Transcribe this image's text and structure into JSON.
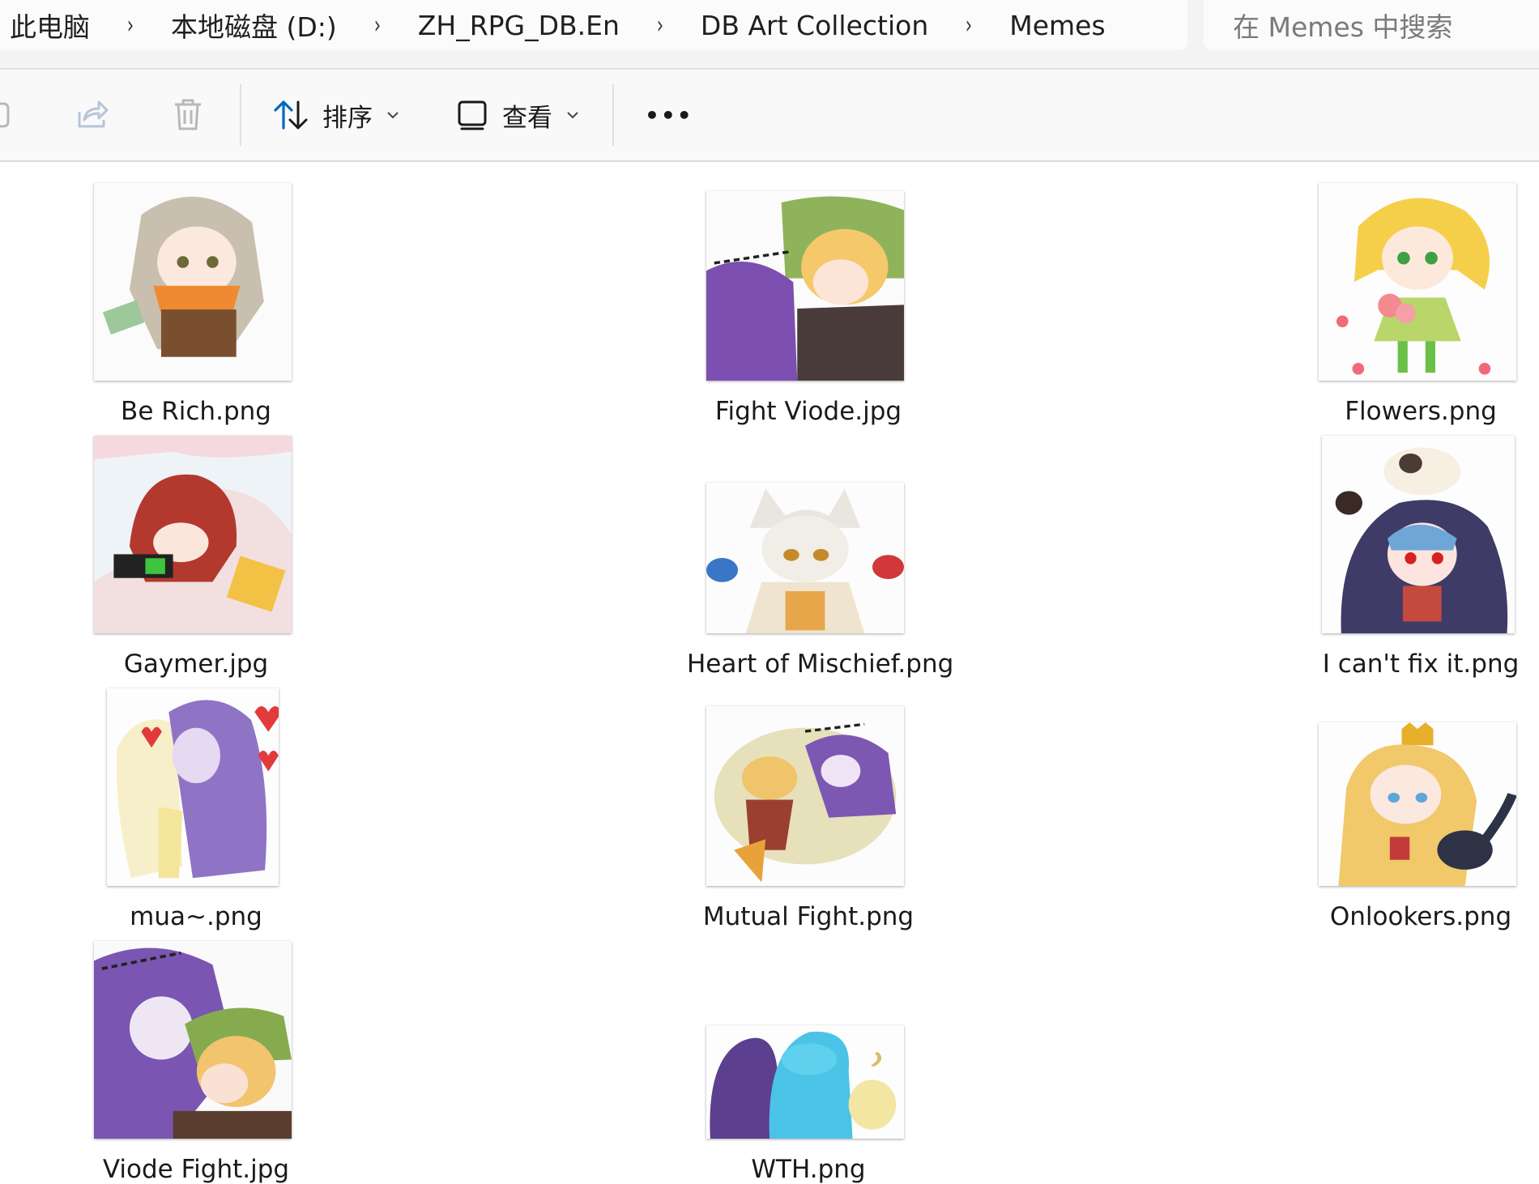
{
  "breadcrumb": {
    "items": [
      "此电脑",
      "本地磁盘 (D:)",
      "ZH_RPG_DB.En",
      "DB Art Collection",
      "Memes"
    ],
    "separator": "›"
  },
  "search": {
    "placeholder": "在 Memes 中搜索"
  },
  "toolbar": {
    "sort_label": "排序",
    "view_label": "查看",
    "more_label": "•••"
  },
  "files": [
    {
      "name": "Be Rich.png",
      "icon": "chibi-scarf-money"
    },
    {
      "name": "Fight Viode.jpg",
      "icon": "chibi-fight-green-hat"
    },
    {
      "name": "Flowers.png",
      "icon": "chibi-blonde-flowers"
    },
    {
      "name": "Gaymer.jpg",
      "icon": "chibi-red-hair-gaming"
    },
    {
      "name": "Heart of Mischief.png",
      "icon": "chibi-white-fox-potions"
    },
    {
      "name": "I can't fix it.png",
      "icon": "chibi-hooded-blue-hair"
    },
    {
      "name": "mua~.png",
      "icon": "chibi-kiss-hearts"
    },
    {
      "name": "Mutual Fight.png",
      "icon": "chibi-mutual-fight-cloud"
    },
    {
      "name": "Onlookers.png",
      "icon": "chibi-crown-blonde-cat"
    },
    {
      "name": "Viode Fight.jpg",
      "icon": "chibi-purple-green-fight"
    },
    {
      "name": "WTH.png",
      "icon": "chibi-purple-blue-yellow"
    }
  ],
  "colors": {
    "background": "#ffffff",
    "address_bar": "#f3f3f3",
    "command_bar": "#f9f9f9",
    "accent": "#0067c0"
  }
}
